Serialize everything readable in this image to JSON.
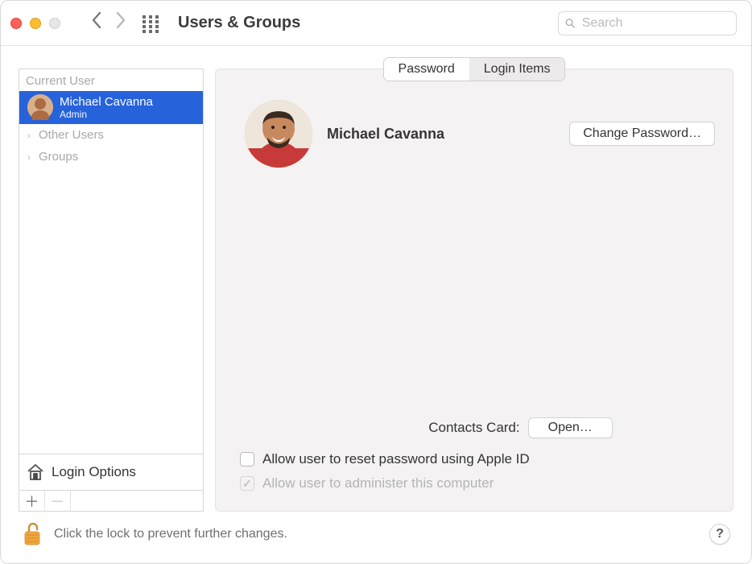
{
  "window": {
    "title": "Users & Groups"
  },
  "search": {
    "placeholder": "Search",
    "value": ""
  },
  "sidebar": {
    "section_label": "Current User",
    "current_user": {
      "name": "Michael Cavanna",
      "role": "Admin"
    },
    "items": [
      {
        "label": "Other Users"
      },
      {
        "label": "Groups"
      }
    ],
    "login_options_label": "Login Options"
  },
  "tabs": {
    "password": "Password",
    "login_items": "Login Items"
  },
  "detail": {
    "user_name": "Michael Cavanna",
    "change_password_btn": "Change Password…",
    "contacts_label": "Contacts Card:",
    "open_btn": "Open…",
    "reset_pw_label": "Allow user to reset password using Apple ID",
    "admin_label": "Allow user to administer this computer"
  },
  "footer": {
    "lock_text": "Click the lock to prevent further changes.",
    "help_label": "?"
  }
}
